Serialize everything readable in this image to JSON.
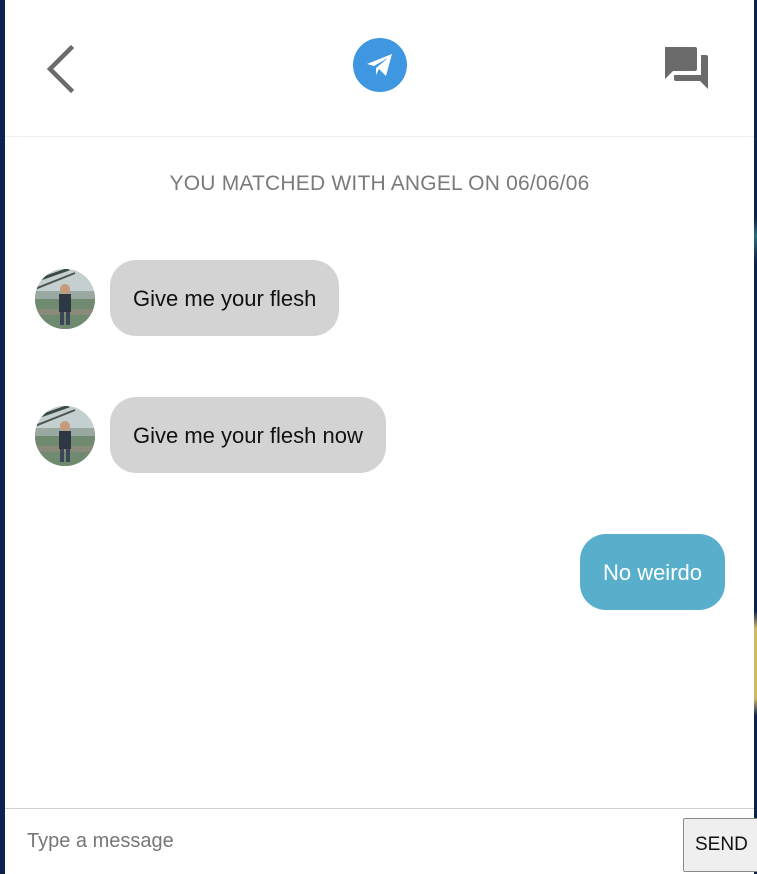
{
  "header": {
    "back_icon": "chevron-left-icon",
    "logo_icon": "paper-plane-icon",
    "chats_icon": "forum-icon"
  },
  "conversation": {
    "match_notice": "YOU MATCHED WITH ANGEL ON 06/06/06",
    "messages": [
      {
        "from": "them",
        "text": "Give me your flesh"
      },
      {
        "from": "them",
        "text": "Give me your flesh now"
      },
      {
        "from": "me",
        "text": "No weirdo"
      }
    ]
  },
  "composer": {
    "placeholder": "Type a message",
    "send_label": "SEND"
  },
  "colors": {
    "accent": "#3e97e0",
    "incoming_bubble": "#d3d3d3",
    "outgoing_bubble": "#58afcb",
    "icon_gray": "#6b6b6b"
  }
}
